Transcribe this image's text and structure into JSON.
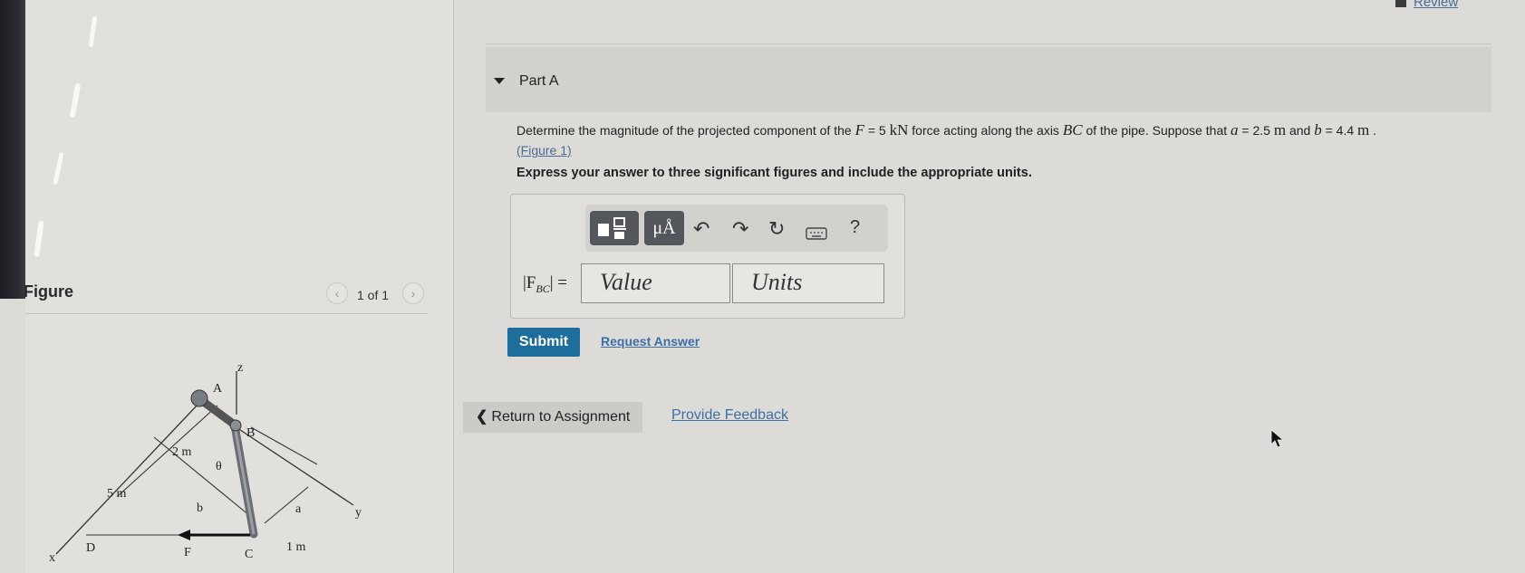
{
  "header": {
    "review_label": "Review"
  },
  "figure_panel": {
    "title": "Figure",
    "pager_text": "1 of 1",
    "prev_icon": "chevron-left-icon",
    "next_icon": "chevron-right-icon",
    "diagram_labels": {
      "z": "z",
      "x": "x",
      "y": "y",
      "A": "A",
      "B": "B",
      "C": "C",
      "D": "D",
      "F": "F",
      "two_m": "2 m",
      "five_m": "5 m",
      "one_m": "1 m",
      "a": "a",
      "b": "b",
      "theta": "θ"
    }
  },
  "part": {
    "title": "Part A"
  },
  "question": {
    "seg1": "Determine the magnitude of the projected component of the ",
    "F_var": "F",
    "F_eq": " = 5 ",
    "kN": "kN",
    "seg2": " force acting along the axis ",
    "BC": "BC",
    "seg3": " of the pipe. Suppose that ",
    "a_var": "a",
    "a_eq": " = 2.5 ",
    "m1": "m",
    "seg4": " and ",
    "b_var": "b",
    "b_eq": " = 4.4 ",
    "m2": "m",
    "seg5": " .",
    "figure_link": "(Figure 1)"
  },
  "instruction": "Express your answer to three significant figures and include the appropriate units.",
  "toolbar": {
    "template_icon": "template-icon",
    "units_label": "μÅ",
    "undo_icon": "undo-icon",
    "redo_icon": "redo-icon",
    "reset_icon": "reset-icon",
    "keyboard_icon": "keyboard-icon",
    "help_label": "?"
  },
  "answer": {
    "label": "|F",
    "label_sub": "BC",
    "label_end": "| =",
    "value_placeholder": "Value",
    "units_placeholder": "Units"
  },
  "actions": {
    "submit_label": "Submit",
    "request_label": "Request Answer",
    "return_label": "Return to Assignment",
    "feedback_label": "Provide Feedback"
  },
  "colors": {
    "submit_bg": "#1d6e9b",
    "link": "#3c6fa6",
    "toolbar_btn": "#53575c"
  }
}
